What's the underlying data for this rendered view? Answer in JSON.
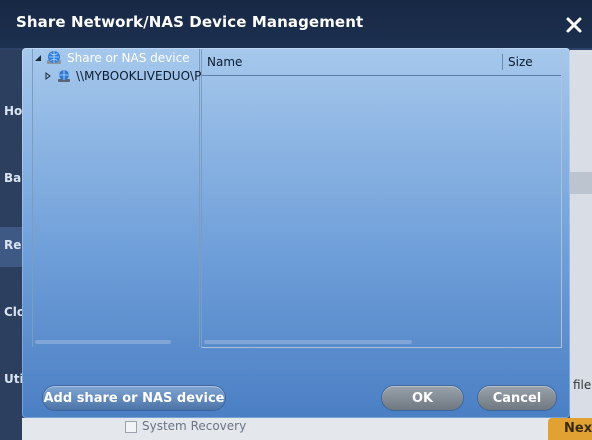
{
  "dialog": {
    "title": "Share Network/NAS Device Management",
    "close_glyph": "✕"
  },
  "tree": {
    "root_label": "Share or NAS device",
    "child_label": "\\\\MYBOOKLIVEDUO\\P"
  },
  "list": {
    "columns": [
      "Name",
      "Size"
    ]
  },
  "buttons": {
    "add": "Add share or NAS device",
    "ok": "OK",
    "cancel": "Cancel"
  },
  "background": {
    "sidebar_items": [
      "Ho",
      "Ba",
      "Re",
      "Clo",
      "Uti"
    ],
    "right_text": "file.",
    "bottom_option": "System Recovery",
    "next_button": "Nex"
  },
  "colors": {
    "accent_orange": "#e1a233",
    "dialog_title_bar": "#172844"
  }
}
